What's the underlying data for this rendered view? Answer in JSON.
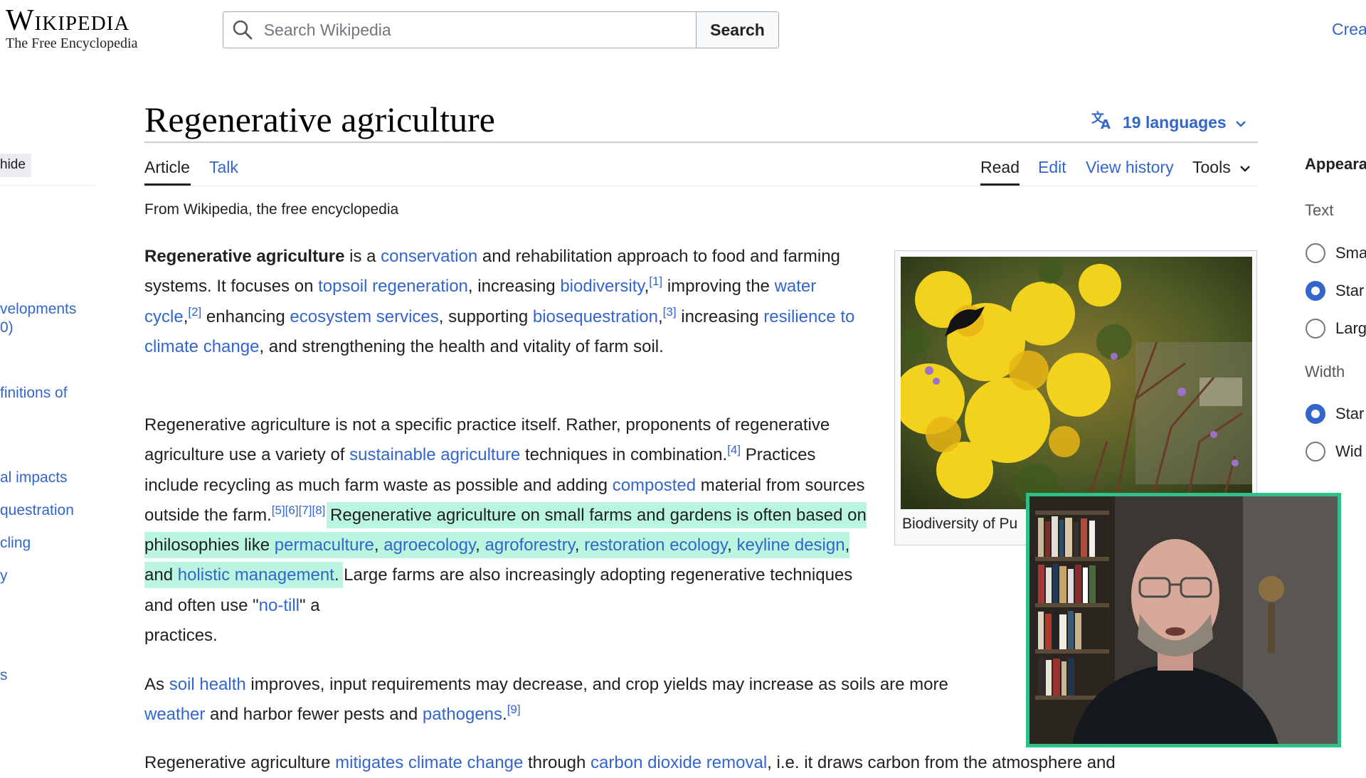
{
  "header": {
    "wordmark": "Wikipedia",
    "tagline": "The Free Encyclopedia",
    "search_placeholder": "Search Wikipedia",
    "search_button": "Search",
    "create_account": "Crea"
  },
  "article": {
    "title": "Regenerative agriculture",
    "languages": "19 languages",
    "from": "From Wikipedia, the free encyclopedia"
  },
  "tabs": {
    "article": "Article",
    "talk": "Talk",
    "read": "Read",
    "edit": "Edit",
    "history": "View history",
    "tools": "Tools"
  },
  "toc": {
    "hide": "hide",
    "items": [
      "velopments",
      "0)",
      "finitions of",
      "al impacts",
      "questration",
      "cling",
      "y",
      "s"
    ]
  },
  "appearance": {
    "title": "Appeara",
    "text_label": "Text",
    "text_options": [
      "Sma",
      "Star",
      "Larg"
    ],
    "text_selected": "Star",
    "width_label": "Width",
    "width_options": [
      "Star",
      "Wid"
    ],
    "width_selected": "Star"
  },
  "paragraphs": {
    "p1": {
      "bold": "Regenerative agriculture",
      "t1": " is a ",
      "l_conservation": "conservation",
      "t2": " and rehabilitation approach to food and farming systems. It focuses on ",
      "l_topsoil": "topsoil regeneration",
      "t3": ", increasing ",
      "l_biodiversity": "biodiversity",
      "t3b": ",",
      "ref1": "[1]",
      "t4": " improving the ",
      "l_water": "water cycle",
      "t4b": ",",
      "ref2": "[2]",
      "t5": " enhancing ",
      "l_ecosystem": "ecosystem services",
      "t6": ", supporting ",
      "l_bioseq": "biosequestration",
      "t6b": ",",
      "ref3": "[3]",
      "t7": " increasing ",
      "l_resilience": "resilience to climate change",
      "t8": ", and strengthening the health and vitality of farm soil."
    },
    "p2": {
      "t1": "Regenerative agriculture is not a specific practice itself. Rather, proponents of regenerative agriculture use a variety of ",
      "l_sustainable": "sustainable agriculture",
      "t2": " techniques in combination.",
      "ref4": "[4]",
      "t3": " Practices include recycling as much farm waste as possible and adding ",
      "l_composted": "composted",
      "t4": " material from sources outside the farm.",
      "refs5_8": "[5][6][7][8]",
      "hl1": "Regenerative agriculture on small farms and gardens is often based on philosophies like ",
      "l_permaculture": "permaculture",
      "hl_c1": ", ",
      "l_agroecology": "agroecology",
      "hl_c2": ", ",
      "l_agroforestry": "agroforestry",
      "hl_c3": ", ",
      "l_restoration": "restoration ecology",
      "hl_c4": ", ",
      "l_keyline": "keyline design",
      "hl_and": ", and ",
      "l_holistic": "holistic management",
      "hl_end": ".",
      "t5": " Large farms are also increasingly adopting regenerative techniques and often use \"",
      "l_notill": "no-till",
      "t6": "\" a",
      "t7": "practices."
    },
    "p3": {
      "t1": "As ",
      "l_soilhealth": "soil health",
      "t2": " improves, input requirements may decrease, and crop yields may increase as soils are more",
      "l_weather": "weather",
      "t3": " and harbor fewer pests and ",
      "l_pathogens": "pathogens",
      "t3b": ".",
      "ref9": "[9]"
    },
    "p4": {
      "t1": "Regenerative agriculture ",
      "l_mitigates": "mitigates climate change",
      "t2": " through ",
      "l_co2": "carbon dioxide removal",
      "t3": ", i.e. it draws carbon from the atmosphere and"
    }
  },
  "infobox": {
    "caption": "Biodiversity of Pu"
  },
  "colors": {
    "link": "#3366cc",
    "highlight": "#b9f5df",
    "webcam_border": "#2fbf87"
  }
}
